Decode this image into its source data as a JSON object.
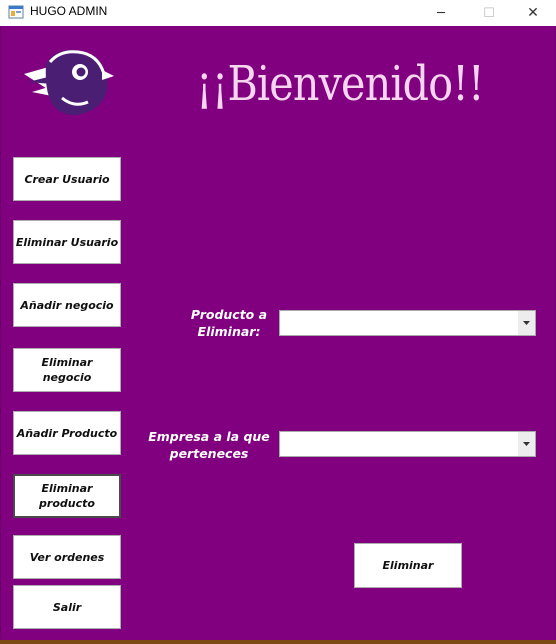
{
  "window": {
    "title": "HUGO ADMIN",
    "minimize_glyph": "─",
    "maximize_glyph": "☐",
    "close_glyph": "✕"
  },
  "header": {
    "welcome": "¡¡Bienvenido!!"
  },
  "sidebar": {
    "items": [
      {
        "label": "Crear Usuario"
      },
      {
        "label": "Eliminar Usuario"
      },
      {
        "label": "Añadir negocio"
      },
      {
        "label": "Eliminar negocio"
      },
      {
        "label": "Añadir Producto"
      },
      {
        "label": "Eliminar producto"
      },
      {
        "label": "Ver ordenes"
      },
      {
        "label": "Salir"
      }
    ]
  },
  "form": {
    "product_label_line1": "Producto a",
    "product_label_line2": "Eliminar:",
    "product_value": "",
    "company_label_line1": "Empresa a la que",
    "company_label_line2": "perteneces",
    "company_value": "",
    "delete_button": "Eliminar"
  },
  "colors": {
    "background": "#800080",
    "heading": "#f6d6ee",
    "logo_body": "#4a1f73"
  },
  "icons": {
    "app": "window-app-icon",
    "logo": "bird-logo-icon",
    "dropdown": "chevron-down-icon"
  }
}
